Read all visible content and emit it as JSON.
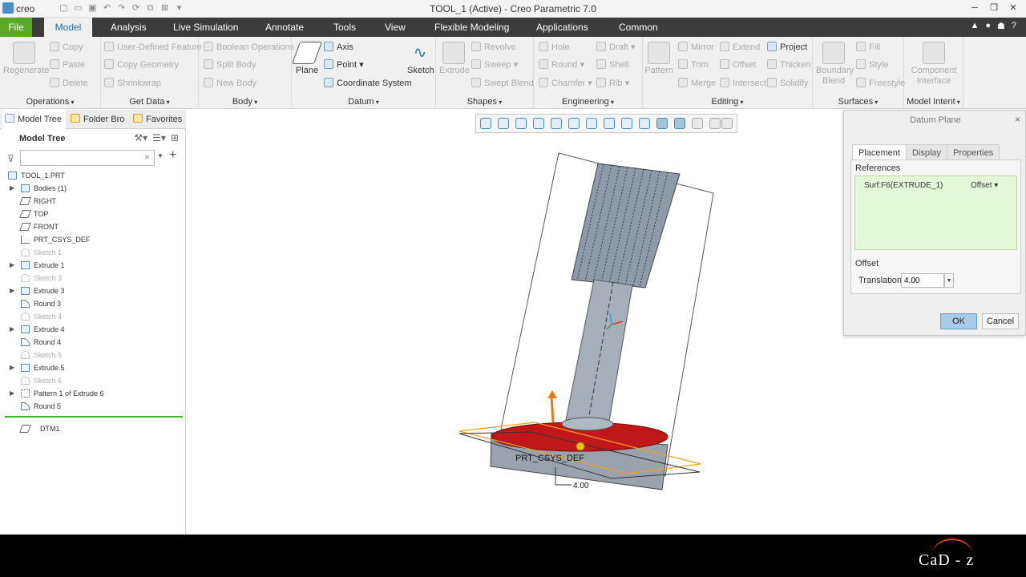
{
  "app": {
    "logo": "creo",
    "title": "TOOL_1 (Active) - Creo Parametric 7.0"
  },
  "quick_access": [
    "new-icon",
    "open-icon",
    "save-icon",
    "undo-icon",
    "redo-icon",
    "regenerate-icon",
    "windows-icon",
    "close-icon",
    "more-icon"
  ],
  "tabs": [
    {
      "label": "File"
    },
    {
      "label": "Model"
    },
    {
      "label": "Analysis"
    },
    {
      "label": "Live Simulation"
    },
    {
      "label": "Annotate"
    },
    {
      "label": "Tools"
    },
    {
      "label": "View"
    },
    {
      "label": "Flexible Modeling"
    },
    {
      "label": "Applications"
    },
    {
      "label": "Common"
    }
  ],
  "ribbon": {
    "operations": {
      "label": "Operations",
      "regenerate": "Regenerate",
      "copy": "Copy",
      "paste": "Paste",
      "delete": "Delete"
    },
    "getdata": {
      "label": "Get Data",
      "udf": "User-Defined Feature",
      "copy_geometry": "Copy Geometry",
      "shrinkwrap": "Shrinkwrap"
    },
    "body": {
      "label": "Body",
      "boolean": "Boolean Operations",
      "split": "Split Body",
      "new": "New Body"
    },
    "datum": {
      "label": "Datum",
      "plane": "Plane",
      "axis": "Axis",
      "point": "Point",
      "csys": "Coordinate System",
      "sketch": "Sketch"
    },
    "shapes": {
      "label": "Shapes",
      "extrude": "Extrude",
      "revolve": "Revolve",
      "sweep": "Sweep",
      "swept_blend": "Swept Blend"
    },
    "engineering": {
      "label": "Engineering",
      "hole": "Hole",
      "round": "Round",
      "chamfer": "Chamfer",
      "draft": "Draft",
      "shell": "Shell",
      "rib": "Rib"
    },
    "editing": {
      "label": "Editing",
      "pattern": "Pattern",
      "mirror": "Mirror",
      "trim": "Trim",
      "merge": "Merge",
      "extend": "Extend",
      "offset": "Offset",
      "intersect": "Intersect",
      "project": "Project",
      "thicken": "Thicken",
      "solidify": "Solidify"
    },
    "surfaces": {
      "label": "Surfaces",
      "boundary_blend": "Boundary Blend",
      "fill": "Fill",
      "style": "Style",
      "freestyle": "Freestyle"
    },
    "model_intent": {
      "label": "Model Intent",
      "component_interface": "Component Interface"
    }
  },
  "panel": {
    "tabs": [
      "Model Tree",
      "Folder Bro",
      "Favorites"
    ],
    "heading": "Model Tree",
    "search_value": "",
    "tree": [
      {
        "label": "TOOL_1.PRT",
        "icon": "part-icon",
        "expand": false,
        "disabled": false
      },
      {
        "label": "Bodies (1)",
        "icon": "bodies-icon",
        "expand": true,
        "disabled": false
      },
      {
        "label": "RIGHT",
        "icon": "datum-plane-icon",
        "expand": false,
        "disabled": false
      },
      {
        "label": "TOP",
        "icon": "datum-plane-icon",
        "expand": false,
        "disabled": false
      },
      {
        "label": "FRONT",
        "icon": "datum-plane-icon",
        "expand": false,
        "disabled": false
      },
      {
        "label": "PRT_CSYS_DEF",
        "icon": "csys-icon",
        "expand": false,
        "disabled": false
      },
      {
        "label": "Sketch 1",
        "icon": "sketch-icon",
        "expand": false,
        "disabled": true
      },
      {
        "label": "Extrude 1",
        "icon": "extrude-icon",
        "expand": true,
        "disabled": false
      },
      {
        "label": "Sketch 3",
        "icon": "sketch-icon",
        "expand": false,
        "disabled": true
      },
      {
        "label": "Extrude 3",
        "icon": "extrude-icon",
        "expand": true,
        "disabled": false
      },
      {
        "label": "Round 3",
        "icon": "round-icon",
        "expand": false,
        "disabled": false
      },
      {
        "label": "Sketch 4",
        "icon": "sketch-icon",
        "expand": false,
        "disabled": true
      },
      {
        "label": "Extrude 4",
        "icon": "extrude-icon",
        "expand": true,
        "disabled": false
      },
      {
        "label": "Round 4",
        "icon": "round-icon",
        "expand": false,
        "disabled": false
      },
      {
        "label": "Sketch 5",
        "icon": "sketch-icon",
        "expand": false,
        "disabled": true
      },
      {
        "label": "Extrude 5",
        "icon": "extrude-icon",
        "expand": true,
        "disabled": false
      },
      {
        "label": "Sketch 6",
        "icon": "sketch-icon",
        "expand": false,
        "disabled": true
      },
      {
        "label": "Pattern 1 of Extrude 6",
        "icon": "pattern-icon",
        "expand": true,
        "disabled": false
      },
      {
        "label": "Round 5",
        "icon": "round-icon",
        "expand": false,
        "disabled": false
      }
    ],
    "new_feature": "DTM1"
  },
  "viewport": {
    "csys_label": "PRT_CSYS_DEF",
    "dimension": "4.00"
  },
  "dialog": {
    "title": "Datum Plane",
    "tabs": [
      "Placement",
      "Display",
      "Properties"
    ],
    "references_label": "References",
    "reference": "Surf:F6(EXTRUDE_1)",
    "constraint": "Offset",
    "offset_label": "Offset",
    "translation_label": "Translation",
    "translation_value": "4.00",
    "ok": "OK",
    "cancel": "Cancel"
  },
  "watermark": "CaD - z",
  "colors": {
    "file_tab": "#5aaa28",
    "tab_bar": "#3c3c3c",
    "selection": "#e4f7d7",
    "ok_button": "#a9cbe8",
    "model_red": "#c0181a",
    "plane_orange": "#f0a020"
  }
}
